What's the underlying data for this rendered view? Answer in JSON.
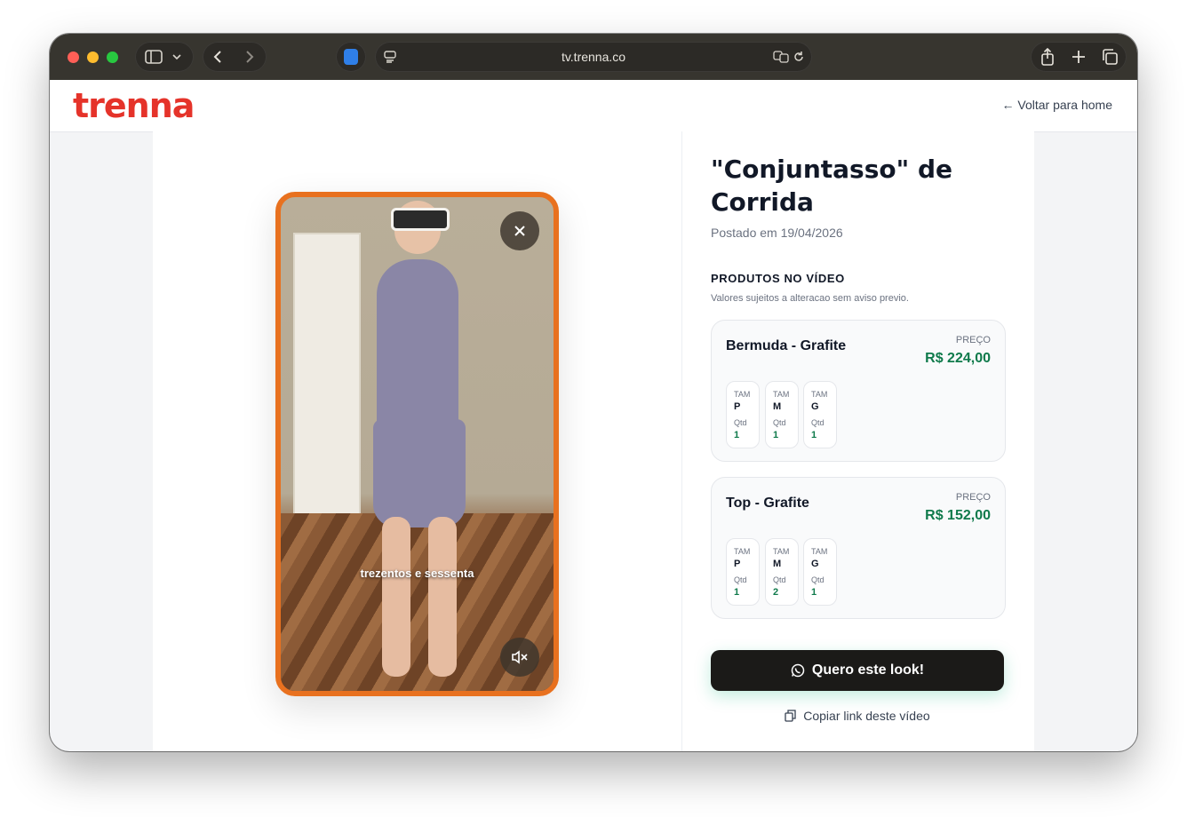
{
  "browser": {
    "url": "tv.trenna.co"
  },
  "site": {
    "logo": "trenna",
    "back_link": "← Voltar para home"
  },
  "video": {
    "caption": "trezentos e sessenta",
    "close_icon": "close-icon",
    "mute_icon": "speaker-muted-icon"
  },
  "post": {
    "title": "\"Conjuntasso\" de Corrida",
    "posted": "Postado em 19/04/2026"
  },
  "products_section": {
    "title": "PRODUTOS NO VÍDEO",
    "subtitle": "Valores sujeitos a alteracao sem aviso previo."
  },
  "products": [
    {
      "name": "Bermuda - Grafite",
      "price_label": "PREÇO",
      "price": "R$ 224,00",
      "sizes": [
        {
          "size_label": "TAM",
          "size": "P",
          "qty_label": "Qtd",
          "qty": "1"
        },
        {
          "size_label": "TAM",
          "size": "M",
          "qty_label": "Qtd",
          "qty": "1"
        },
        {
          "size_label": "TAM",
          "size": "G",
          "qty_label": "Qtd",
          "qty": "1"
        }
      ]
    },
    {
      "name": "Top - Grafite",
      "price_label": "PREÇO",
      "price": "R$ 152,00",
      "sizes": [
        {
          "size_label": "TAM",
          "size": "P",
          "qty_label": "Qtd",
          "qty": "1"
        },
        {
          "size_label": "TAM",
          "size": "M",
          "qty_label": "Qtd",
          "qty": "2"
        },
        {
          "size_label": "TAM",
          "size": "G",
          "qty_label": "Qtd",
          "qty": "1"
        }
      ]
    }
  ],
  "actions": {
    "cta": "Quero este look!",
    "copy_link": "Copiar link deste vídeo"
  },
  "colors": {
    "brand": "#e5332a",
    "video_border": "#e8711f",
    "price": "#0f7a4b",
    "cta_bg": "#1b1a18"
  }
}
